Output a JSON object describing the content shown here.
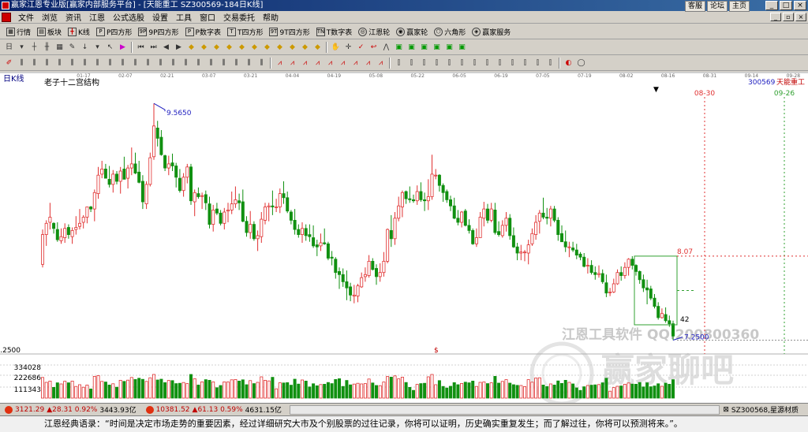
{
  "window": {
    "title": "赢家江恩专业版[赢家内部服务平台] - [天能重工  SZ300569-184日K线]",
    "links": [
      "客服",
      "论坛",
      "主页"
    ],
    "controls": [
      "_",
      "□",
      "×"
    ]
  },
  "menu": {
    "items": [
      "文件",
      "浏览",
      "资讯",
      "江恩",
      "公式选股",
      "设置",
      "工具",
      "窗口",
      "交易委托",
      "帮助"
    ],
    "controls": [
      "_",
      "▫",
      "×"
    ]
  },
  "toolbar1": {
    "items": [
      "行情",
      "板块",
      "K线",
      "P四方形",
      "9P四方形",
      "P数字表",
      "T四方形",
      "9T四方形",
      "T数字表",
      "江恩轮",
      "赢家轮",
      "六角形",
      "赢家服务"
    ]
  },
  "chart_data": {
    "type": "candlestick",
    "panel_label": "日K线",
    "title": "老子十二宫结构",
    "stock_code": "300569",
    "stock_name": "天能重工",
    "date_ticks": [
      "01-17",
      "02-07",
      "02-21",
      "03-07",
      "03-21",
      "04-04",
      "04-19",
      "05-08",
      "05-22",
      "06-05",
      "06-19",
      "07-05",
      "07-19",
      "08-02",
      "08-16",
      "08-31",
      "09-14",
      "09-28"
    ],
    "ylim": [
      7.1,
      9.7
    ],
    "high_annotation": "9.5650",
    "low_annotation": "7.2500",
    "price_axis_label": "7.2500",
    "target_price": "8.07",
    "box_value": "42",
    "vertical_markers": [
      {
        "label": "08-30",
        "color": "#e03030"
      },
      {
        "label": "09-26",
        "color": "#30a030"
      }
    ],
    "volume_ticks": [
      "334028",
      "222686",
      "111343"
    ],
    "watermark_lines": [
      "江恩工具软件",
      "QQ:200800360",
      "赢家聊吧"
    ],
    "colors": {
      "up": "#e03030",
      "down": "#109010",
      "annotation": "#2020c0"
    },
    "ohlc": [
      [
        7.99,
        8.33,
        7.96,
        8.28
      ],
      [
        8.28,
        8.42,
        8.17,
        8.39
      ],
      [
        8.4,
        8.59,
        8.33,
        8.45
      ],
      [
        8.39,
        8.4,
        8.29,
        8.34
      ],
      [
        8.33,
        8.4,
        8.21,
        8.23
      ],
      [
        8.22,
        8.34,
        8.19,
        8.26
      ],
      [
        8.25,
        8.39,
        8.2,
        8.34
      ],
      [
        8.35,
        8.38,
        8.24,
        8.28
      ],
      [
        8.26,
        8.35,
        8.19,
        8.32
      ],
      [
        8.33,
        8.46,
        8.28,
        8.35
      ],
      [
        8.36,
        8.53,
        8.33,
        8.39
      ],
      [
        8.4,
        8.47,
        8.34,
        8.45
      ],
      [
        8.45,
        8.55,
        8.39,
        8.55
      ],
      [
        8.55,
        8.56,
        8.5,
        8.53
      ],
      [
        8.53,
        8.72,
        8.41,
        8.69
      ],
      [
        8.68,
        8.94,
        8.63,
        8.86
      ],
      [
        8.87,
        9.0,
        8.83,
        8.92
      ],
      [
        8.92,
        8.97,
        8.83,
        8.83
      ],
      [
        8.82,
        8.95,
        8.74,
        8.77
      ],
      [
        8.77,
        8.91,
        8.69,
        8.87
      ],
      [
        8.87,
        8.9,
        8.77,
        8.8
      ],
      [
        8.8,
        8.94,
        8.68,
        8.9
      ],
      [
        8.92,
        9.04,
        8.82,
        8.82
      ],
      [
        8.83,
        8.96,
        8.73,
        8.93
      ],
      [
        8.93,
        9.13,
        8.86,
        8.97
      ],
      [
        8.97,
        9.08,
        8.87,
        8.88
      ],
      [
        8.89,
        9.0,
        8.78,
        8.79
      ],
      [
        8.8,
        8.86,
        8.53,
        8.6
      ],
      [
        8.58,
        8.8,
        8.53,
        8.77
      ],
      [
        8.77,
        9.08,
        8.75,
        9.03
      ],
      [
        9.04,
        9.56,
        9.01,
        9.34
      ],
      [
        9.32,
        9.39,
        9.14,
        9.22
      ],
      [
        9.23,
        9.3,
        9.05,
        9.06
      ],
      [
        9.05,
        9.06,
        8.9,
        8.93
      ],
      [
        8.93,
        9.05,
        8.86,
        8.97
      ],
      [
        8.98,
        9.07,
        8.9,
        8.95
      ],
      [
        8.95,
        8.98,
        8.74,
        8.84
      ],
      [
        8.83,
        8.92,
        8.69,
        8.71
      ],
      [
        8.71,
        8.88,
        8.65,
        8.84
      ],
      [
        8.84,
        8.97,
        8.78,
        8.94
      ],
      [
        8.94,
        8.97,
        8.57,
        8.61
      ],
      [
        8.6,
        8.72,
        8.46,
        8.69
      ],
      [
        8.68,
        8.74,
        8.63,
        8.65
      ],
      [
        8.66,
        8.69,
        8.53,
        8.66
      ],
      [
        8.67,
        8.71,
        8.52,
        8.59
      ],
      [
        8.58,
        8.65,
        8.34,
        8.38
      ],
      [
        8.38,
        8.57,
        8.31,
        8.52
      ],
      [
        8.53,
        8.59,
        8.47,
        8.49
      ],
      [
        8.49,
        8.52,
        8.37,
        8.39
      ],
      [
        8.39,
        8.54,
        8.33,
        8.5
      ],
      [
        8.51,
        8.59,
        8.4,
        8.52
      ],
      [
        8.52,
        8.7,
        8.48,
        8.58
      ],
      [
        8.58,
        8.75,
        8.54,
        8.62
      ],
      [
        8.61,
        8.68,
        8.52,
        8.59
      ],
      [
        8.6,
        8.72,
        8.4,
        8.41
      ],
      [
        8.41,
        8.46,
        8.26,
        8.3
      ],
      [
        8.3,
        8.51,
        8.24,
        8.38
      ],
      [
        8.38,
        8.41,
        8.22,
        8.24
      ],
      [
        8.24,
        8.32,
        8.12,
        8.27
      ],
      [
        8.26,
        8.5,
        8.2,
        8.43
      ],
      [
        8.42,
        8.59,
        8.38,
        8.55
      ],
      [
        8.55,
        8.59,
        8.41,
        8.56
      ],
      [
        8.56,
        8.71,
        8.47,
        8.55
      ],
      [
        8.55,
        8.63,
        8.5,
        8.55
      ],
      [
        8.55,
        8.73,
        8.49,
        8.68
      ],
      [
        8.68,
        8.8,
        8.58,
        8.64
      ],
      [
        8.64,
        8.7,
        8.49,
        8.51
      ],
      [
        8.5,
        8.52,
        8.38,
        8.42
      ],
      [
        8.42,
        8.53,
        8.28,
        8.33
      ],
      [
        8.33,
        8.38,
        8.25,
        8.28
      ],
      [
        8.28,
        8.4,
        8.2,
        8.34
      ],
      [
        8.34,
        8.38,
        8.22,
        8.27
      ],
      [
        8.28,
        8.38,
        8.21,
        8.26
      ],
      [
        8.25,
        8.37,
        8.15,
        8.17
      ],
      [
        8.18,
        8.23,
        8.07,
        8.16
      ],
      [
        8.17,
        8.29,
        8.12,
        8.2
      ],
      [
        8.2,
        8.34,
        8.18,
        8.19
      ],
      [
        8.19,
        8.21,
        8.03,
        8.05
      ],
      [
        8.06,
        8.12,
        7.98,
        8.05
      ],
      [
        8.04,
        8.06,
        7.85,
        7.91
      ],
      [
        7.92,
        7.96,
        7.75,
        7.89
      ],
      [
        7.89,
        7.95,
        7.77,
        7.82
      ],
      [
        7.82,
        7.93,
        7.64,
        7.76
      ],
      [
        7.77,
        7.81,
        7.63,
        7.69
      ],
      [
        7.68,
        7.79,
        7.61,
        7.69
      ],
      [
        7.68,
        7.8,
        7.62,
        7.78
      ],
      [
        7.77,
        7.91,
        7.76,
        7.86
      ],
      [
        7.87,
        7.96,
        7.82,
        7.89
      ],
      [
        7.88,
        8.08,
        7.86,
        8.02
      ],
      [
        8.02,
        8.05,
        7.93,
        7.94
      ],
      [
        7.95,
        7.99,
        7.79,
        7.87
      ],
      [
        7.87,
        8.0,
        7.82,
        7.91
      ],
      [
        7.91,
        8.11,
        7.87,
        8.02
      ],
      [
        8.02,
        8.34,
        8.0,
        8.33
      ],
      [
        8.32,
        8.47,
        8.16,
        8.24
      ],
      [
        8.24,
        8.5,
        8.18,
        8.44
      ],
      [
        8.44,
        8.65,
        8.41,
        8.56
      ],
      [
        8.55,
        8.71,
        8.45,
        8.69
      ],
      [
        8.7,
        8.71,
        8.58,
        8.63
      ],
      [
        8.63,
        8.75,
        8.59,
        8.62
      ],
      [
        8.62,
        8.67,
        8.59,
        8.61
      ],
      [
        8.61,
        8.76,
        8.57,
        8.7
      ],
      [
        8.7,
        8.79,
        8.6,
        8.62
      ],
      [
        8.62,
        8.69,
        8.51,
        8.61
      ],
      [
        8.61,
        8.82,
        8.52,
        8.65
      ],
      [
        8.65,
        9.06,
        8.62,
        8.87
      ],
      [
        8.86,
        8.92,
        8.82,
        8.86
      ],
      [
        8.86,
        8.87,
        8.7,
        8.76
      ],
      [
        8.76,
        8.78,
        8.6,
        8.69
      ],
      [
        8.7,
        8.72,
        8.59,
        8.62
      ],
      [
        8.62,
        8.66,
        8.51,
        8.56
      ],
      [
        8.56,
        8.64,
        8.43,
        8.44
      ],
      [
        8.44,
        8.52,
        8.37,
        8.4
      ],
      [
        8.4,
        8.51,
        8.35,
        8.5
      ],
      [
        8.51,
        8.53,
        8.36,
        8.37
      ],
      [
        8.37,
        8.43,
        8.29,
        8.32
      ],
      [
        8.32,
        8.34,
        8.18,
        8.19
      ],
      [
        8.19,
        8.34,
        8.16,
        8.25
      ],
      [
        8.25,
        8.5,
        8.25,
        8.45
      ],
      [
        8.44,
        8.6,
        8.36,
        8.53
      ],
      [
        8.53,
        8.58,
        8.39,
        8.42
      ],
      [
        8.42,
        8.59,
        8.4,
        8.53
      ],
      [
        8.52,
        8.59,
        8.28,
        8.3
      ],
      [
        8.31,
        8.41,
        8.26,
        8.28
      ],
      [
        8.27,
        8.42,
        8.25,
        8.37
      ],
      [
        8.37,
        8.5,
        8.31,
        8.44
      ],
      [
        8.44,
        8.48,
        8.23,
        8.27
      ],
      [
        8.27,
        8.35,
        8.15,
        8.16
      ],
      [
        8.16,
        8.2,
        8.03,
        8.1
      ],
      [
        8.1,
        8.18,
        8.03,
        8.11
      ],
      [
        8.11,
        8.13,
        8.02,
        8.11
      ],
      [
        8.1,
        8.23,
        7.99,
        8.18
      ],
      [
        8.19,
        8.34,
        8.17,
        8.29
      ],
      [
        8.28,
        8.47,
        8.23,
        8.4
      ],
      [
        8.41,
        8.52,
        8.29,
        8.49
      ],
      [
        8.49,
        8.64,
        8.43,
        8.45
      ],
      [
        8.45,
        8.54,
        8.38,
        8.44
      ],
      [
        8.44,
        8.56,
        8.36,
        8.53
      ],
      [
        8.53,
        8.56,
        8.4,
        8.42
      ],
      [
        8.42,
        8.45,
        8.22,
        8.28
      ],
      [
        8.29,
        8.37,
        8.21,
        8.21
      ],
      [
        8.21,
        8.32,
        8.11,
        8.16
      ],
      [
        8.16,
        8.21,
        8.06,
        8.16
      ],
      [
        8.15,
        8.21,
        8.11,
        8.13
      ],
      [
        8.13,
        8.19,
        8.04,
        8.08
      ],
      [
        8.09,
        8.11,
        8.03,
        8.06
      ],
      [
        8.06,
        8.1,
        7.96,
        7.97
      ],
      [
        7.98,
        8.05,
        7.9,
        7.98
      ],
      [
        7.98,
        8.03,
        7.89,
        7.91
      ],
      [
        7.91,
        7.97,
        7.84,
        7.89
      ],
      [
        7.89,
        7.98,
        7.86,
        7.9
      ],
      [
        7.9,
        7.94,
        7.8,
        7.82
      ],
      [
        7.81,
        7.89,
        7.67,
        7.71
      ],
      [
        7.72,
        7.76,
        7.68,
        7.72
      ],
      [
        7.72,
        7.85,
        7.71,
        7.8
      ],
      [
        7.8,
        7.94,
        7.79,
        7.91
      ],
      [
        7.91,
        7.97,
        7.83,
        7.88
      ],
      [
        7.88,
        8.01,
        7.85,
        7.96
      ],
      [
        7.96,
        8.05,
        7.88,
        8.04
      ],
      [
        8.04,
        8.07,
        7.94,
        7.98
      ],
      [
        7.98,
        7.99,
        7.88,
        7.92
      ],
      [
        7.92,
        7.93,
        7.8,
        7.84
      ],
      [
        7.84,
        7.89,
        7.72,
        7.76
      ],
      [
        7.76,
        7.84,
        7.6,
        7.74
      ],
      [
        7.75,
        7.78,
        7.64,
        7.66
      ],
      [
        7.66,
        7.7,
        7.56,
        7.58
      ],
      [
        7.58,
        7.62,
        7.45,
        7.47
      ],
      [
        7.47,
        7.56,
        7.46,
        7.51
      ],
      [
        7.5,
        7.57,
        7.42,
        7.44
      ],
      [
        7.44,
        7.49,
        7.38,
        7.41
      ],
      [
        7.41,
        7.44,
        7.25,
        7.29
      ]
    ]
  },
  "statusbar": {
    "index1_value": "3121.29",
    "index1_change": "▲28.31 0.92%",
    "index1_amount": "3443.93亿",
    "index2_value": "10381.52",
    "index2_change": "▲61.13 0.59%",
    "index2_amount": "4631.15亿",
    "stock": "SZ300568,星源材质"
  },
  "quote": "江恩经典语录：“时间是决定市场走势的重要因素，经过详细研究大市及个别股票的过往记录，你将可以证明，历史确实重复发生；而了解过往，你将可以预测将来。”。"
}
